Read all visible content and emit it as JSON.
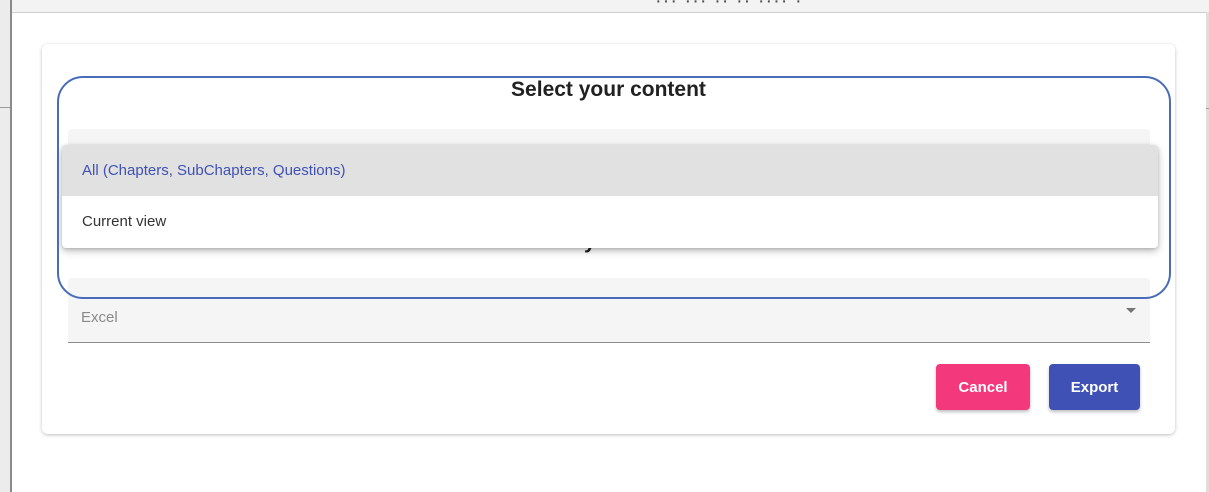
{
  "background": {
    "title_fragment": "··· ··· ·· ·· ···· ·"
  },
  "dialog": {
    "content_section": {
      "title": "Select your content",
      "selected_value": ""
    },
    "format_section": {
      "title": "Select your format",
      "value": "Excel"
    },
    "buttons": {
      "cancel_label": "Cancel",
      "export_label": "Export"
    }
  },
  "dropdown": {
    "options": [
      {
        "label": "All (Chapters, SubChapters, Questions)",
        "selected": true
      },
      {
        "label": "Current view",
        "selected": false
      }
    ]
  },
  "colors": {
    "primary": "#3f51b5",
    "accent": "#f3387b",
    "highlight_outline": "#4a6cb8"
  }
}
